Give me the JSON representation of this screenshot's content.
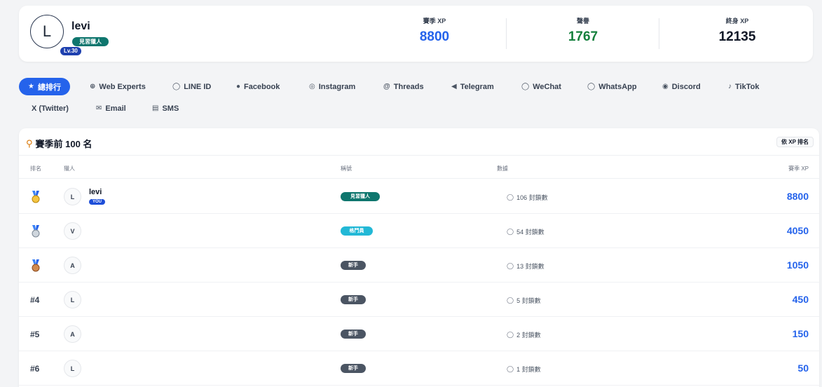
{
  "profile": {
    "avatar_letter": "L",
    "level": "Lv.30",
    "name": "levi",
    "title": "見習獵人",
    "stats": [
      {
        "label": "賽季 XP",
        "value": "8800",
        "color": "#2563eb"
      },
      {
        "label": "聲譽",
        "value": "1767",
        "color": "#15803d"
      },
      {
        "label": "終身 XP",
        "value": "12135",
        "color": "#111827"
      }
    ]
  },
  "tabs": {
    "row1": [
      {
        "label": "總排行",
        "icon": "trophy-icon",
        "glyph": "🏆",
        "active": true
      },
      {
        "label": "Web Experts",
        "icon": "globe-icon",
        "glyph": "⊕"
      },
      {
        "label": "LINE ID",
        "icon": "chat-bubble-icon",
        "glyph": "◌"
      },
      {
        "label": "Facebook",
        "icon": "facebook-icon",
        "glyph": "●"
      },
      {
        "label": "Instagram",
        "icon": "instagram-icon",
        "glyph": "◎"
      },
      {
        "label": "Threads",
        "icon": "threads-icon",
        "glyph": "@"
      },
      {
        "label": "Telegram",
        "icon": "telegram-icon",
        "glyph": "◀"
      },
      {
        "label": "WeChat",
        "icon": "wechat-icon",
        "glyph": "◌"
      },
      {
        "label": "WhatsApp",
        "icon": "whatsapp-icon",
        "glyph": "◌"
      },
      {
        "label": "Discord",
        "icon": "discord-icon",
        "glyph": "◉"
      },
      {
        "label": "TikTok",
        "icon": "tiktok-icon",
        "glyph": "♪"
      }
    ],
    "row2": [
      {
        "label": "X (Twitter)",
        "icon": "",
        "glyph": ""
      },
      {
        "label": "Email",
        "icon": "mail-icon",
        "glyph": "✉"
      },
      {
        "label": "SMS",
        "icon": "sms-icon",
        "glyph": "▤"
      }
    ]
  },
  "board": {
    "title": "賽季前 100 名",
    "sort_button": "依 XP 排名",
    "headers": {
      "rank": "排名",
      "player": "獵人",
      "title": "稱號",
      "data": "數據",
      "xp": "賽季 XP"
    },
    "rows": [
      {
        "rank": "",
        "medal": "gold",
        "avatar": "L",
        "name": "levi",
        "you": "YOU",
        "title": "見習獵人",
        "title_color": "#0f766e",
        "data": "106 封鎖數",
        "xp": "8800"
      },
      {
        "rank": "",
        "medal": "silver",
        "avatar": "V",
        "name": "",
        "you": "",
        "title": "格鬥員",
        "title_color": "#22b8d6",
        "data": "54 封鎖數",
        "xp": "4050"
      },
      {
        "rank": "",
        "medal": "bronze",
        "avatar": "A",
        "name": "",
        "you": "",
        "title": "新手",
        "title_color": "#4b5563",
        "data": "13 封鎖數",
        "xp": "1050"
      },
      {
        "rank": "#4",
        "medal": "",
        "avatar": "L",
        "name": "",
        "you": "",
        "title": "新手",
        "title_color": "#4b5563",
        "data": "5 封鎖數",
        "xp": "450"
      },
      {
        "rank": "#5",
        "medal": "",
        "avatar": "A",
        "name": "",
        "you": "",
        "title": "新手",
        "title_color": "#4b5563",
        "data": "2 封鎖數",
        "xp": "150"
      },
      {
        "rank": "#6",
        "medal": "",
        "avatar": "L",
        "name": "",
        "you": "",
        "title": "新手",
        "title_color": "#4b5563",
        "data": "1 封鎖數",
        "xp": "50"
      }
    ]
  }
}
